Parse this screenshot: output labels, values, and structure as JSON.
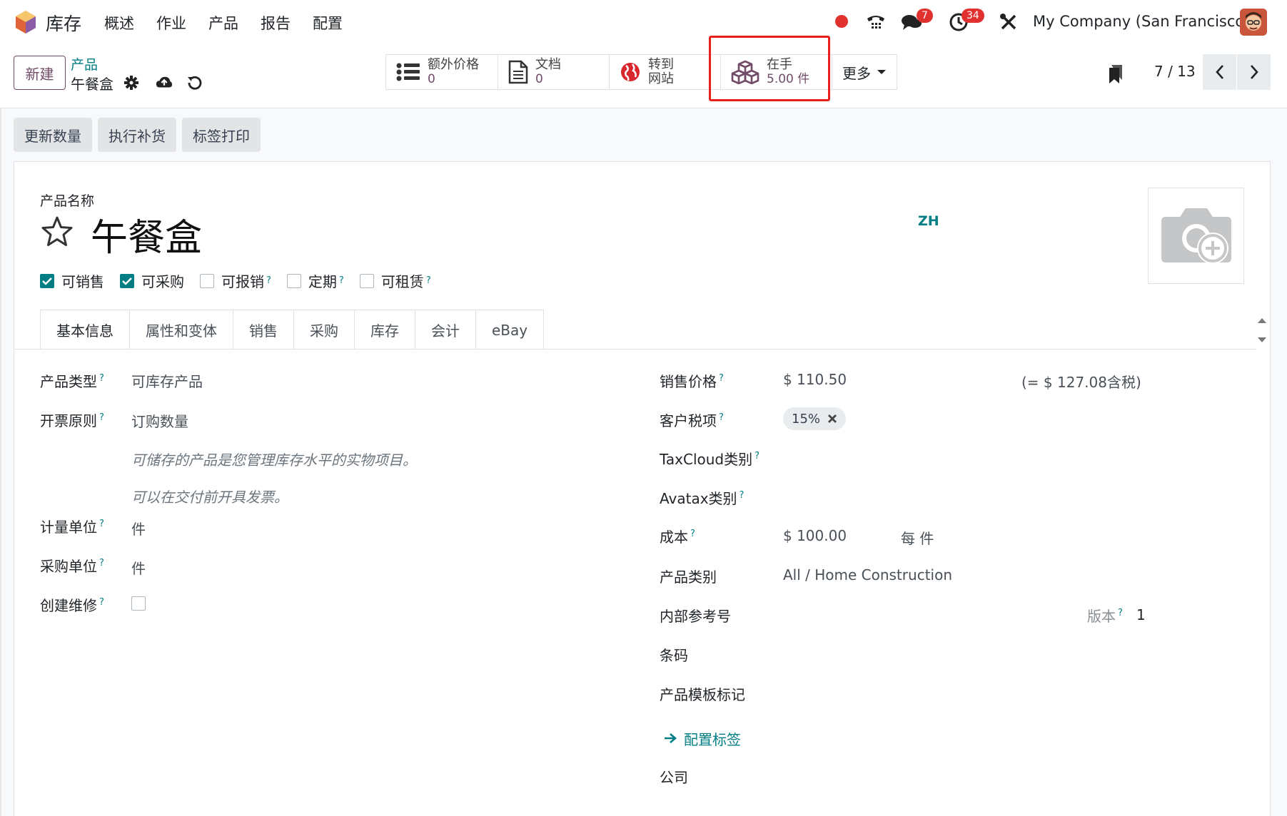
{
  "topnav": {
    "app_name": "库存",
    "menu": [
      "概述",
      "作业",
      "产品",
      "报告",
      "配置"
    ],
    "chat_badge": "7",
    "activity_badge": "34",
    "company": "My Company (San Francisco)"
  },
  "control": {
    "new_label": "新建",
    "breadcrumb_parent": "产品",
    "breadcrumb_current": "午餐盒",
    "smart_buttons": [
      {
        "label": "额外价格",
        "value": "0",
        "icon": "list-icon"
      },
      {
        "label": "文档",
        "value": "0",
        "icon": "document-icon"
      },
      {
        "label": "转到",
        "value": "网站",
        "icon": "globe-icon"
      },
      {
        "label": "在手",
        "value": "5.00 件",
        "icon": "cubes-icon"
      }
    ],
    "more_label": "更多",
    "pager": "7 / 13"
  },
  "actions": [
    "更新数量",
    "执行补货",
    "标签打印"
  ],
  "sheet": {
    "product_name_label": "产品名称",
    "product_name": "午餐盒",
    "lang": "ZH",
    "checkboxes": [
      {
        "label": "可销售",
        "checked": true,
        "help": false
      },
      {
        "label": "可采购",
        "checked": true,
        "help": false
      },
      {
        "label": "可报销",
        "checked": false,
        "help": true
      },
      {
        "label": "定期",
        "checked": false,
        "help": true
      },
      {
        "label": "可租赁",
        "checked": false,
        "help": true
      }
    ],
    "tabs": [
      "基本信息",
      "属性和变体",
      "销售",
      "采购",
      "库存",
      "会计",
      "eBay"
    ],
    "left": {
      "product_type_label": "产品类型",
      "product_type": "可库存产品",
      "invoice_policy_label": "开票原则",
      "invoice_policy": "订购数量",
      "note1": "可储存的产品是您管理库存水平的实物项目。",
      "note2": "可以在交付前开具发票。",
      "uom_label": "计量单位",
      "uom": "件",
      "purchase_uom_label": "采购单位",
      "purchase_uom": "件",
      "create_repair_label": "创建维修"
    },
    "right": {
      "sales_price_label": "销售价格",
      "sales_price": "$ 110.50",
      "sales_price_tax": "(= $ 127.08含税)",
      "customer_tax_label": "客户税项",
      "customer_tax": "15%",
      "taxcloud_label": "TaxCloud类别",
      "avatax_label": "Avatax类别",
      "cost_label": "成本",
      "cost": "$ 100.00",
      "cost_per": "每 件",
      "category_label": "产品类别",
      "category": "All / Home Construction",
      "internal_ref_label": "内部参考号",
      "version_label": "版本",
      "version": "1",
      "barcode_label": "条码",
      "template_tags_label": "产品模板标记",
      "configure_tags": "配置标签",
      "company_label": "公司"
    }
  },
  "colors": {
    "brand": "#714b67",
    "accent": "#017e84",
    "highlight": "#e8201d"
  }
}
